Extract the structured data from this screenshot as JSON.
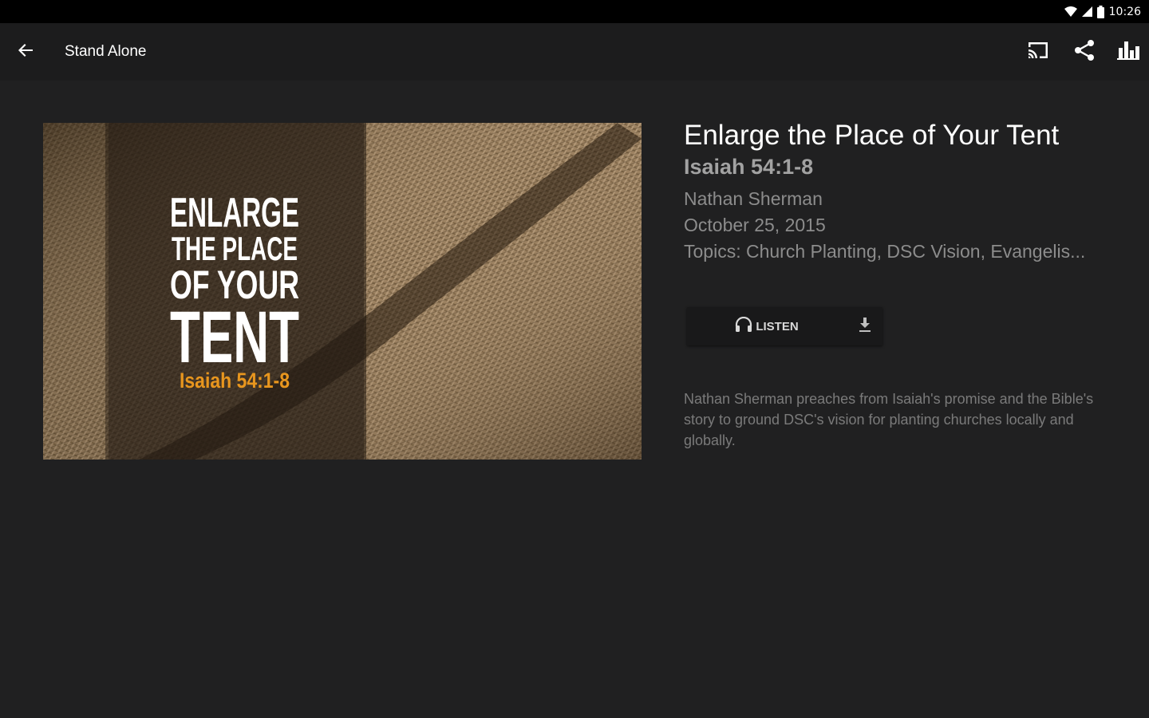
{
  "status_bar": {
    "time": "10:26",
    "icons": [
      "wifi-icon",
      "cell-signal-icon",
      "battery-icon"
    ]
  },
  "app_bar": {
    "title": "Stand Alone",
    "back_icon": "arrow-back-icon",
    "actions": [
      "cast-icon",
      "share-icon",
      "bar-chart-icon"
    ]
  },
  "artwork": {
    "line1": "ENLARGE",
    "line2": "THE PLACE",
    "line3": "OF YOUR",
    "line4": "TENT",
    "reference": "Isaiah 54:1-8"
  },
  "sermon": {
    "title": "Enlarge the Place of Your Tent",
    "scripture": "Isaiah 54:1-8",
    "speaker": "Nathan Sherman",
    "date": "October 25, 2015",
    "topics": "Topics: Church Planting, DSC Vision, Evangelis..."
  },
  "actions": {
    "listen_label": "LISTEN",
    "listen_icon": "headphones-icon",
    "download_icon": "download-icon"
  },
  "description": "Nathan Sherman preaches from Isaiah's promise and the Bible's story to ground DSC's vision for planting churches locally and globally.",
  "colors": {
    "background": "#202021",
    "status_bar": "#000000",
    "reference_accent": "#e8961e"
  }
}
